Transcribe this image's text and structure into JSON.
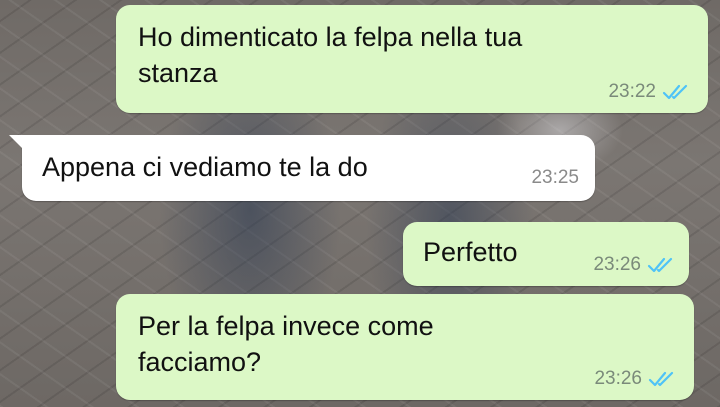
{
  "colors": {
    "outgoing_bubble": "#dcf8c6",
    "incoming_bubble": "#ffffff",
    "read_ticks": "#4fc3f7"
  },
  "messages": [
    {
      "direction": "outgoing",
      "text": "Ho dimenticato la felpa nella tua\nstanza",
      "time": "23:22",
      "status_icon": "double-check-read-icon"
    },
    {
      "direction": "incoming",
      "text": "Appena ci vediamo te la do",
      "time": "23:25"
    },
    {
      "direction": "outgoing",
      "text": "Perfetto",
      "time": "23:26",
      "status_icon": "double-check-read-icon"
    },
    {
      "direction": "outgoing",
      "text": "Per la felpa invece come\nfacciamo?",
      "time": "23:26",
      "status_icon": "double-check-read-icon"
    }
  ]
}
